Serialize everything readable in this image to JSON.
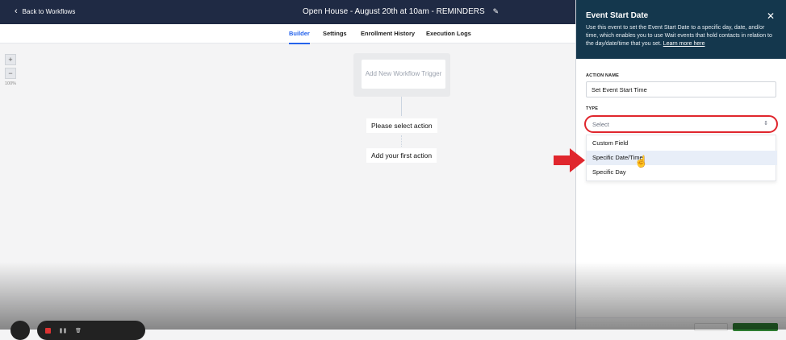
{
  "header": {
    "back_label": "Back to Workflows",
    "title": "Open House - August 20th at 10am - REMINDERS"
  },
  "tabs": [
    {
      "label": "Builder",
      "active": true
    },
    {
      "label": "Settings",
      "active": false
    },
    {
      "label": "Enrollment History",
      "active": false
    },
    {
      "label": "Execution Logs",
      "active": false
    }
  ],
  "canvas": {
    "zoom_in": "+",
    "zoom_out": "−",
    "zoom_level": "100%",
    "trigger_text": "Add New Workflow Trigger",
    "select_action": "Please select action",
    "first_action": "Add your first action"
  },
  "panel": {
    "title": "Event Start Date",
    "description": "Use this event to set the Event Start Date to a specific day, date, and/or time, which enables you to use Wait events that hold contacts in relation to the day/date/time that you set.",
    "learn_more": "Learn more here",
    "action_name_label": "ACTION NAME",
    "action_name_value": "Set Event Start Time",
    "type_label": "TYPE",
    "type_placeholder": "Select",
    "options": [
      "Custom Field",
      "Specific Date/Time",
      "Specific Day"
    ],
    "highlighted_option": "Specific Date/Time"
  },
  "colors": {
    "topbar": "#1f2a44",
    "panel_header": "#14374d",
    "accent": "#2563eb",
    "annotation_red": "#e0262d"
  }
}
